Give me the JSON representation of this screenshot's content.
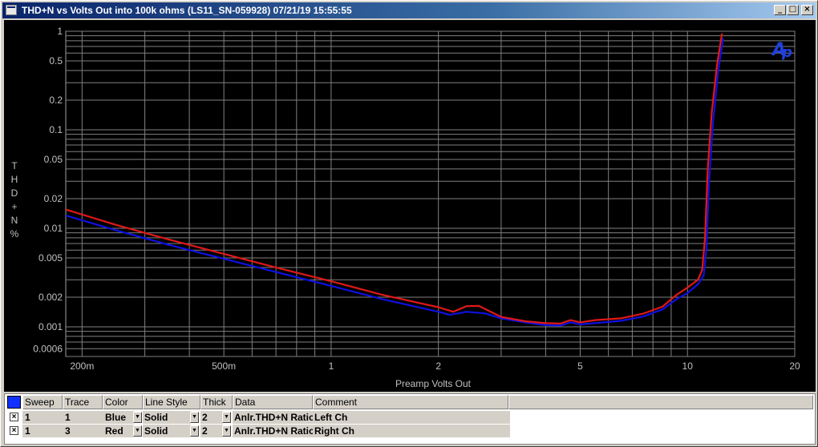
{
  "window": {
    "title": "THD+N vs Volts Out into 100k ohms (LS11_SN-059928)  07/21/19 15:55:55",
    "controls": {
      "minimize": "_",
      "maximize": "□",
      "close": "×"
    }
  },
  "chart_data": {
    "type": "line",
    "xlabel": "Preamp Volts Out",
    "ylabel_chars": [
      "T",
      "H",
      "D",
      "+",
      "N",
      "%"
    ],
    "xscale": "log",
    "yscale": "log",
    "xlim": [
      0.18,
      20
    ],
    "ylim": [
      0.0005,
      1
    ],
    "grid": true,
    "x_ticks": [
      {
        "v": 0.2,
        "label": "200m"
      },
      {
        "v": 0.5,
        "label": "500m"
      },
      {
        "v": 1,
        "label": "1"
      },
      {
        "v": 2,
        "label": "2"
      },
      {
        "v": 5,
        "label": "5"
      },
      {
        "v": 10,
        "label": "10"
      },
      {
        "v": 20,
        "label": "20"
      }
    ],
    "y_ticks": [
      {
        "v": 1,
        "label": "1"
      },
      {
        "v": 0.5,
        "label": "0.5"
      },
      {
        "v": 0.2,
        "label": "0.2"
      },
      {
        "v": 0.1,
        "label": "0.1"
      },
      {
        "v": 0.05,
        "label": "0.05"
      },
      {
        "v": 0.02,
        "label": "0.02"
      },
      {
        "v": 0.01,
        "label": "0.01"
      },
      {
        "v": 0.005,
        "label": "0.005"
      },
      {
        "v": 0.002,
        "label": "0.002"
      },
      {
        "v": 0.001,
        "label": "0.001"
      },
      {
        "v": 0.0006,
        "label": "0.0006"
      }
    ],
    "series": [
      {
        "color": "#1010e0",
        "points": [
          [
            0.18,
            0.0135
          ],
          [
            0.25,
            0.0095
          ],
          [
            0.35,
            0.0068
          ],
          [
            0.5,
            0.0049
          ],
          [
            0.7,
            0.0036
          ],
          [
            1.0,
            0.0026
          ],
          [
            1.4,
            0.0019
          ],
          [
            2.0,
            0.00142
          ],
          [
            2.15,
            0.00132
          ],
          [
            2.4,
            0.00142
          ],
          [
            2.7,
            0.00137
          ],
          [
            3.0,
            0.00122
          ],
          [
            3.5,
            0.00111
          ],
          [
            4.0,
            0.00104
          ],
          [
            4.4,
            0.00103
          ],
          [
            4.7,
            0.00111
          ],
          [
            5.0,
            0.00106
          ],
          [
            5.5,
            0.00109
          ],
          [
            6.5,
            0.00115
          ],
          [
            7.5,
            0.00127
          ],
          [
            8.5,
            0.0015
          ],
          [
            9.3,
            0.0019
          ],
          [
            10.0,
            0.0022
          ],
          [
            10.7,
            0.0027
          ],
          [
            11.1,
            0.0033
          ],
          [
            11.3,
            0.006
          ],
          [
            11.5,
            0.03
          ],
          [
            11.8,
            0.12
          ],
          [
            12.2,
            0.4
          ],
          [
            12.6,
            0.85
          ]
        ]
      },
      {
        "color": "#e01818",
        "points": [
          [
            0.18,
            0.0155
          ],
          [
            0.25,
            0.0108
          ],
          [
            0.35,
            0.0077
          ],
          [
            0.5,
            0.0055
          ],
          [
            0.7,
            0.004
          ],
          [
            1.0,
            0.0029
          ],
          [
            1.4,
            0.0021
          ],
          [
            2.0,
            0.00158
          ],
          [
            2.2,
            0.00142
          ],
          [
            2.4,
            0.00162
          ],
          [
            2.6,
            0.00163
          ],
          [
            3.0,
            0.00126
          ],
          [
            3.5,
            0.00114
          ],
          [
            4.0,
            0.00109
          ],
          [
            4.4,
            0.00108
          ],
          [
            4.7,
            0.00117
          ],
          [
            5.0,
            0.00111
          ],
          [
            5.5,
            0.00117
          ],
          [
            6.5,
            0.00122
          ],
          [
            7.5,
            0.00136
          ],
          [
            8.5,
            0.0016
          ],
          [
            9.3,
            0.0021
          ],
          [
            10.0,
            0.0025
          ],
          [
            10.7,
            0.003
          ],
          [
            11.0,
            0.0038
          ],
          [
            11.2,
            0.008
          ],
          [
            11.4,
            0.04
          ],
          [
            11.7,
            0.15
          ],
          [
            12.1,
            0.45
          ],
          [
            12.5,
            0.95
          ]
        ]
      }
    ]
  },
  "logo": "ap-logo",
  "table": {
    "headers": [
      "Sweep",
      "Trace",
      "Color",
      "Line Style",
      "Thick",
      "Data",
      "Comment"
    ],
    "rows": [
      {
        "checked": "×",
        "sweep": "1",
        "trace": "1",
        "color": "Blue",
        "line_style": "Solid",
        "thick": "2",
        "data": "Anlr.THD+N Ratio",
        "comment": "Left Ch",
        "swatch": "#1010e0"
      },
      {
        "checked": "×",
        "sweep": "1",
        "trace": "3",
        "color": "Red",
        "line_style": "Solid",
        "thick": "2",
        "data": "Anlr.THD+N Ratio",
        "comment": "Right Ch",
        "swatch": "#e01818"
      }
    ]
  }
}
